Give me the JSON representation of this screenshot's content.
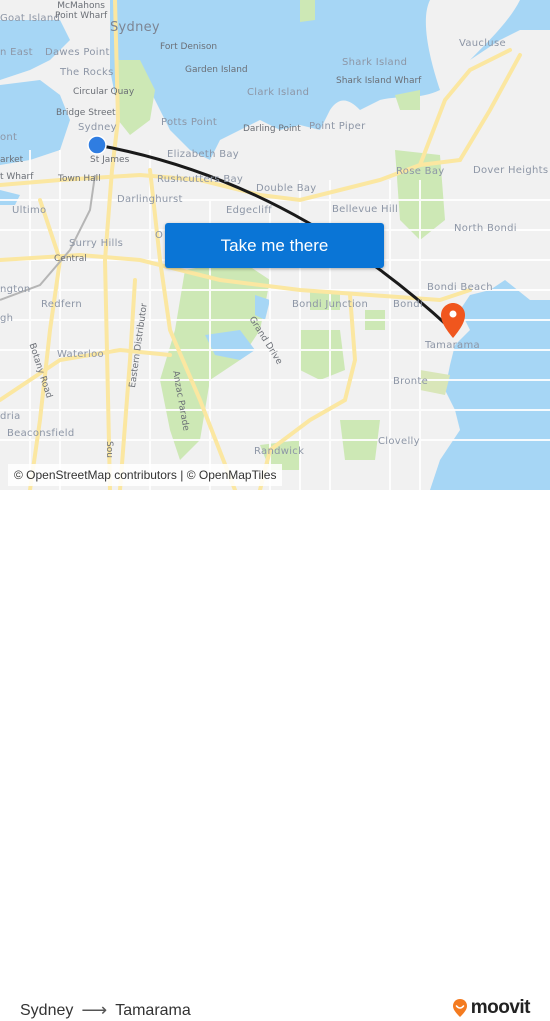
{
  "map": {
    "labels": {
      "goat_island": "Goat Island",
      "mcmahons": "McMahons\nPoint Wharf",
      "sydney_big": "Sydney",
      "east": "n East",
      "dawes_point": "Dawes Point",
      "fort_denison": "Fort Denison",
      "the_rocks": "The Rocks",
      "garden_island": "Garden Island",
      "shark_island": "Shark Island",
      "shark_island_wharf": "Shark Island Wharf",
      "vaucluse": "Vaucluse",
      "circular_quay": "Circular Quay",
      "clark_island": "Clark Island",
      "bridge_street": "Bridge Street",
      "potts_point": "Potts Point",
      "darling_point": "Darling Point",
      "point_piper": "Point Piper",
      "sydney_small": "Sydney",
      "pont": "ont",
      "st_james": "St James",
      "elizabeth_bay": "Elizabeth Bay",
      "rose_bay": "Rose Bay",
      "dover_heights": "Dover Heights",
      "market": "arket",
      "wharf": "t Wharf",
      "town_hall": "Town Hall",
      "rushcutters_bay": "Rushcutters Bay",
      "double_bay": "Double Bay",
      "ultimo": "Ultimo",
      "darlinghurst": "Darlinghurst",
      "edgecliff": "Edgecliff",
      "bellevue_hill": "Bellevue Hill",
      "north_bondi": "North Bondi",
      "surry_hills": "Surry Hills",
      "central": "Central",
      "o_label": "O",
      "ngton": "ngton",
      "bondi_beach": "Bondi Beach",
      "redfern": "Redfern",
      "bondi_junction": "Bondi Junction",
      "bondi": "Bondi",
      "gh": "gh",
      "grand_drive": "Grand Drive",
      "tamarama": "Tamarama",
      "botany_road": "Botany Road",
      "eastern_distributor": "Eastern Distributor",
      "waterloo": "Waterloo",
      "anzac_parade": "Anzac Parade",
      "bronte": "Bronte",
      "dria": "dria",
      "beaconsfield": "Beaconsfield",
      "clovelly": "Clovelly",
      "randwick": "Randwick",
      "south": "Sou"
    },
    "origin": "Sydney",
    "destination": "Tamarama",
    "colors": {
      "water": "#a6d6f5",
      "land": "#f1f1f1",
      "park": "#cde8b5",
      "road": "#fbe7a1",
      "route": "#1a1a1a",
      "origin": "#2f7de1",
      "destination": "#f0561e",
      "cta": "#0a75d6"
    }
  },
  "cta": {
    "label": "Take me there"
  },
  "attribution": "© OpenStreetMap contributors | © OpenMapTiles",
  "footer": {
    "from": "Sydney",
    "arrow": "⟶",
    "to": "Tamarama",
    "brand": "moovit"
  }
}
